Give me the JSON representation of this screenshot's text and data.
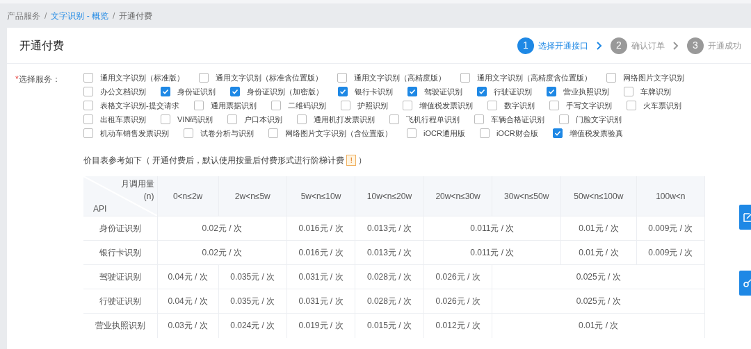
{
  "breadcrumb": {
    "separator": "/",
    "items": [
      {
        "label": "产品服务",
        "kind": "text"
      },
      {
        "label": "文字识别 - 概览",
        "kind": "link"
      },
      {
        "label": "开通付费",
        "kind": "text"
      }
    ]
  },
  "card_title": "开通付费",
  "steps": [
    {
      "number": "1",
      "label": "选择开通接口",
      "selected": true
    },
    {
      "number": "2",
      "label": "确认订单",
      "selected": false
    },
    {
      "number": "3",
      "label": "开通成功",
      "selected": false
    }
  ],
  "service_field": {
    "required_mark": "*",
    "label": "选择服务：",
    "options": [
      {
        "label": "通用文字识别（标准版）",
        "checked": false
      },
      {
        "label": "通用文字识别（标准含位置版）",
        "checked": false
      },
      {
        "label": "通用文字识别（高精度版）",
        "checked": false
      },
      {
        "label": "通用文字识别（高精度含位置版）",
        "checked": false
      },
      {
        "label": "网络图片文字识别",
        "checked": false
      },
      {
        "label": "办公文档识别",
        "checked": false
      },
      {
        "label": "身份证识别",
        "checked": true
      },
      {
        "label": "身份证识别（加密版）",
        "checked": true
      },
      {
        "label": "银行卡识别",
        "checked": true
      },
      {
        "label": "驾驶证识别",
        "checked": true
      },
      {
        "label": "行驶证识别",
        "checked": true
      },
      {
        "label": "营业执照识别",
        "checked": true
      },
      {
        "label": "车牌识别",
        "checked": false
      },
      {
        "label": "表格文字识别-提交请求",
        "checked": false
      },
      {
        "label": "通用票据识别",
        "checked": false
      },
      {
        "label": "二维码识别",
        "checked": false
      },
      {
        "label": "护照识别",
        "checked": false
      },
      {
        "label": "增值税发票识别",
        "checked": false
      },
      {
        "label": "数字识别",
        "checked": false
      },
      {
        "label": "手写文字识别",
        "checked": false
      },
      {
        "label": "火车票识别",
        "checked": false
      },
      {
        "label": "出租车票识别",
        "checked": false
      },
      {
        "label": "VIN码识别",
        "checked": false
      },
      {
        "label": "户口本识别",
        "checked": false
      },
      {
        "label": "通用机打发票识别",
        "checked": false
      },
      {
        "label": "飞机行程单识别",
        "checked": false
      },
      {
        "label": "车辆合格证识别",
        "checked": false
      },
      {
        "label": "门脸文字识别",
        "checked": false
      },
      {
        "label": "机动车销售发票识别",
        "checked": false
      },
      {
        "label": "试卷分析与识别",
        "checked": false
      },
      {
        "label": "网络图片文字识别（含位置版）",
        "checked": false
      },
      {
        "label": "iOCR通用版",
        "checked": false
      },
      {
        "label": "iOCR财会版",
        "checked": false
      },
      {
        "label": "增值税发票验真",
        "checked": true
      }
    ]
  },
  "price_note": {
    "before": "价目表参考如下（ 开通付费后，默认使用按量后付费形式进行阶梯计费",
    "warning": "!",
    "after": "）"
  },
  "price_table": {
    "corner_top": "月调用量",
    "corner_unit": "(n)",
    "corner_bottom": "API",
    "columns": [
      "0<n≤2w",
      "2w<n≤5w",
      "5w<n≤10w",
      "10w<n≤20w",
      "20w<n≤30w",
      "30w<n≤50w",
      "50w<n≤100w",
      "100w<n"
    ],
    "rows": [
      {
        "api": "身份证识别",
        "cells": [
          {
            "text": "0.02元 / 次",
            "colspan": 2
          },
          {
            "text": "0.016元 / 次"
          },
          {
            "text": "0.013元 / 次"
          },
          {
            "text": "0.011元 / 次",
            "colspan": 2
          },
          {
            "text": "0.01元 / 次"
          },
          {
            "text": "0.009元 / 次"
          }
        ]
      },
      {
        "api": "银行卡识别",
        "cells": [
          {
            "text": "0.02元 / 次",
            "colspan": 2
          },
          {
            "text": "0.016元 / 次"
          },
          {
            "text": "0.013元 / 次"
          },
          {
            "text": "0.011元 / 次",
            "colspan": 2
          },
          {
            "text": "0.01元 / 次"
          },
          {
            "text": "0.009元 / 次"
          }
        ]
      },
      {
        "api": "驾驶证识别",
        "cells": [
          {
            "text": "0.04元 / 次"
          },
          {
            "text": "0.035元 / 次"
          },
          {
            "text": "0.031元 / 次"
          },
          {
            "text": "0.028元 / 次"
          },
          {
            "text": "0.026元 / 次"
          },
          {
            "text": "0.025元 / 次",
            "colspan": 3
          }
        ]
      },
      {
        "api": "行驶证识别",
        "cells": [
          {
            "text": "0.04元 / 次"
          },
          {
            "text": "0.035元 / 次"
          },
          {
            "text": "0.031元 / 次"
          },
          {
            "text": "0.028元 / 次"
          },
          {
            "text": "0.026元 / 次"
          },
          {
            "text": "0.025元 / 次",
            "colspan": 3
          }
        ]
      },
      {
        "api": "营业执照识别",
        "cells": [
          {
            "text": "0.03元 / 次"
          },
          {
            "text": "0.024元 / 次"
          },
          {
            "text": "0.019元 / 次"
          },
          {
            "text": "0.015元 / 次"
          },
          {
            "text": "0.012元 / 次"
          },
          {
            "text": "0.01元 / 次",
            "colspan": 3
          }
        ]
      }
    ]
  }
}
